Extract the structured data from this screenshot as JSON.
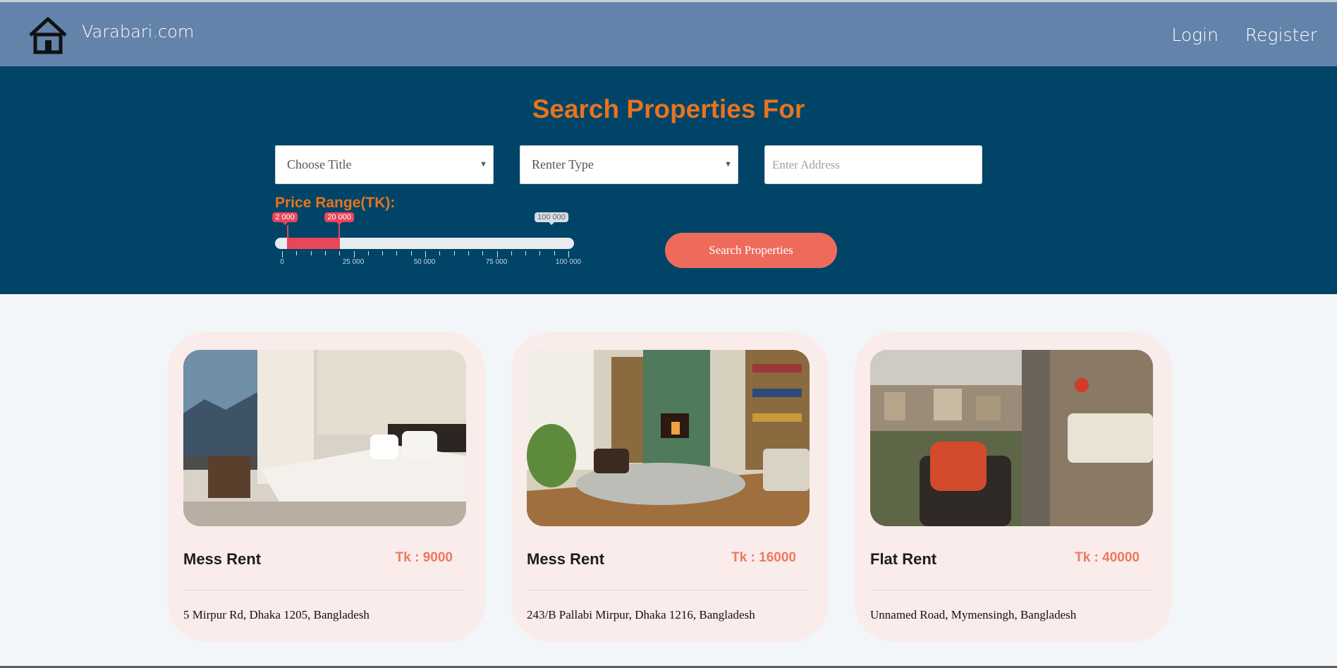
{
  "header": {
    "brand": "Varabari.com",
    "nav": {
      "login": "Login",
      "register": "Register"
    }
  },
  "search": {
    "title": "Search Properties For",
    "title_select": "Choose Title",
    "renter_select": "Renter Type",
    "address_placeholder": "Enter Address",
    "price_label": "Price Range(TK):",
    "range": {
      "min_value": 2000,
      "max_value": 20000,
      "min_label": "2 000",
      "max_label": "20 000",
      "scale_max": 100000,
      "scale_max_label": "100 000"
    },
    "scale_labels": [
      "0",
      "25 000",
      "50 000",
      "75 000",
      "100 000"
    ],
    "button": "Search Properties"
  },
  "listings": [
    {
      "title": "Mess Rent",
      "price": "Tk : 9000",
      "address": "5 Mirpur Rd, Dhaka 1205, Bangladesh",
      "image": "bedroom-photo"
    },
    {
      "title": "Mess Rent",
      "price": "Tk : 16000",
      "address": "243/B Pallabi Mirpur, Dhaka 1216, Bangladesh",
      "image": "living-room-photo"
    },
    {
      "title": "Flat Rent",
      "price": "Tk : 40000",
      "address": "Unnamed Road, Mymensingh, Bangladesh",
      "image": "balcony-photo"
    }
  ],
  "colors": {
    "header": "#6483aa",
    "hero": "#004468",
    "accent": "#e8731e",
    "button": "#ee6b5c",
    "range": "#e9465b",
    "card": "#f9eceb"
  },
  "icons": {
    "logo": "house-icon",
    "select_arrow": "caret-down-icon"
  }
}
